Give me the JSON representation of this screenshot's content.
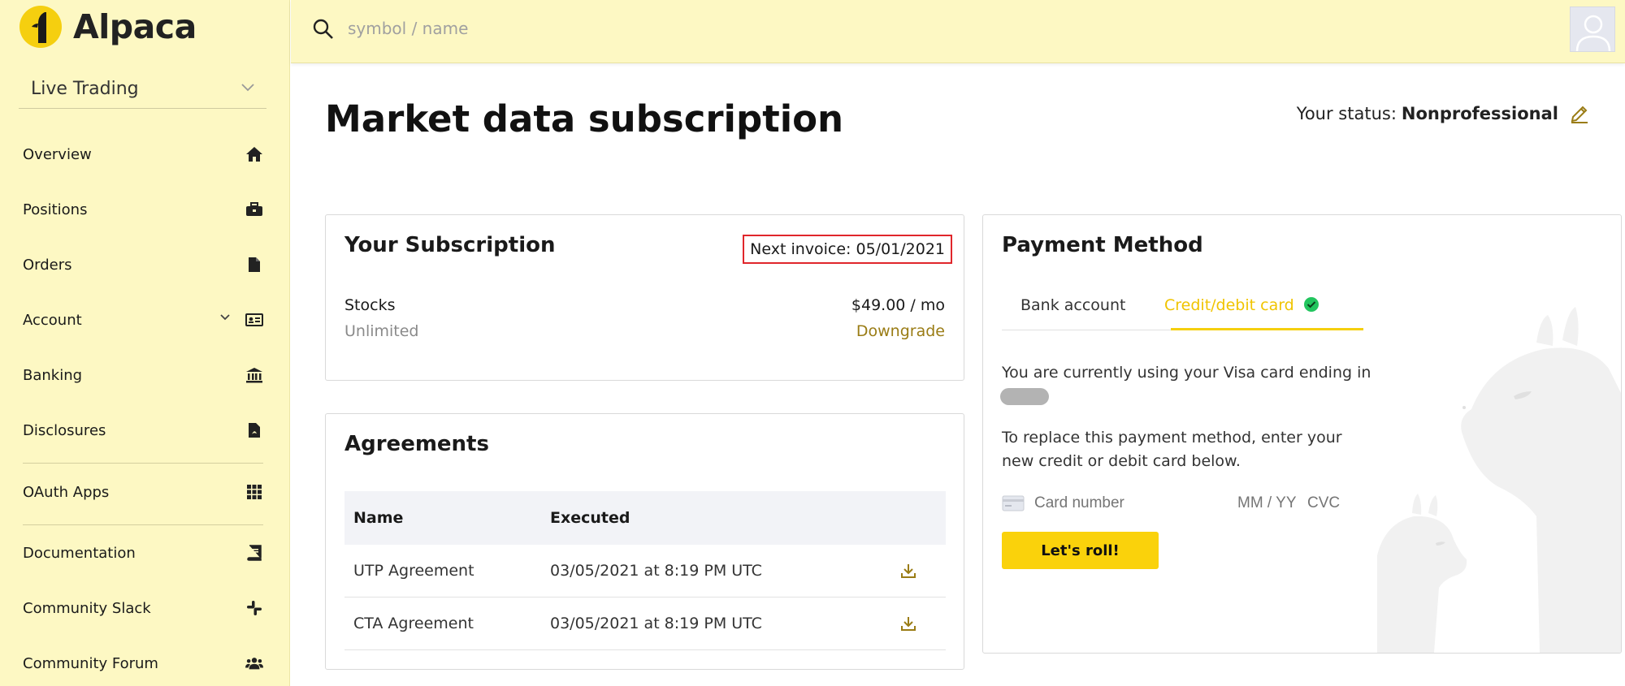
{
  "brand": {
    "name": "Alpaca",
    "accent": "#F5CF0F",
    "sidebar_bg": "#FDF8C3"
  },
  "environment": {
    "label": "Live Trading"
  },
  "sidebar": {
    "items": [
      {
        "label": "Overview",
        "icon": "home-icon"
      },
      {
        "label": "Positions",
        "icon": "briefcase-icon"
      },
      {
        "label": "Orders",
        "icon": "document-icon"
      },
      {
        "label": "Account",
        "icon": "id-card-icon"
      },
      {
        "label": "Banking",
        "icon": "bank-icon"
      },
      {
        "label": "Disclosures",
        "icon": "pdf-file-icon"
      },
      {
        "label": "OAuth Apps",
        "icon": "grid-icon"
      },
      {
        "label": "Documentation",
        "icon": "book-icon"
      },
      {
        "label": "Community Slack",
        "icon": "slack-icon"
      },
      {
        "label": "Community Forum",
        "icon": "users-icon"
      }
    ]
  },
  "search": {
    "placeholder": "symbol / name"
  },
  "page": {
    "title": "Market data subscription",
    "status_label": "Your status:",
    "status_value": "Nonprofessional"
  },
  "subscription": {
    "title": "Your Subscription",
    "next_invoice": "Next invoice: 05/01/2021",
    "plan_name": "Stocks",
    "plan_tier": "Unlimited",
    "price": "$49.00 / mo",
    "downgrade_label": "Downgrade"
  },
  "agreements": {
    "title": "Agreements",
    "columns": [
      "Name",
      "Executed"
    ],
    "rows": [
      {
        "name": "UTP Agreement",
        "executed": "03/05/2021 at 8:19 PM UTC"
      },
      {
        "name": "CTA Agreement",
        "executed": "03/05/2021 at 8:19 PM UTC"
      }
    ]
  },
  "payment": {
    "title": "Payment Method",
    "tabs": [
      "Bank account",
      "Credit/debit card"
    ],
    "active_tab": "Credit/debit card",
    "current_text": "You are currently using your Visa card ending in",
    "replace_text": "To replace this payment method, enter your new credit or debit card below.",
    "card_number_placeholder": "Card number",
    "expiry_placeholder": "MM / YY",
    "cvc_placeholder": "CVC",
    "submit_label": "Let's roll!"
  }
}
